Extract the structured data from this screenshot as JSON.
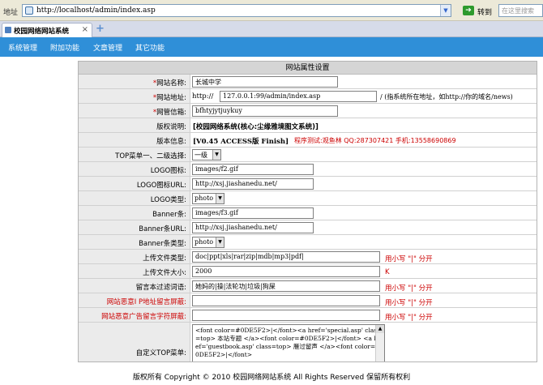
{
  "browser": {
    "address_label": "地址",
    "url": "http://localhost/admin/index.asp",
    "go_label": "转到",
    "search_placeholder": "在这里搜索",
    "tab_title": "校园网络网站系统",
    "tab_close": "×",
    "new_tab": "+"
  },
  "nav": {
    "items": [
      "系统管理",
      "附加功能",
      "文章管理",
      "其它功能"
    ]
  },
  "panel": {
    "title": "网站属性设置",
    "rows": {
      "site_name": {
        "label": "网站名称:",
        "value": "长城中学"
      },
      "site_url": {
        "label": "网站地址:",
        "prefix": "http://",
        "value": "127.0.0.1:99/admin/index.asp",
        "hint": "/ (指系统所在地址，如http://你的域名/news)"
      },
      "admin_email": {
        "label": "网管信箱:",
        "value": "bfhtyjytjuykuy"
      },
      "copyright": {
        "label": "版权说明:",
        "value": "[校园网络系统(核心:尘缘雅境图文系统)]"
      },
      "version": {
        "label": "版本信息:",
        "value": "[V0.45 ACCESS版 Finish]",
        "note": "程序测试:观鱼林 QQ:287307421 手机:13558690869"
      },
      "top_menu": {
        "label": "TOP菜单一、二级选择:",
        "value": "一级"
      },
      "logo_icon": {
        "label": "LOGO图标:",
        "value": "images/f2.gif"
      },
      "logo_url": {
        "label": "LOGO图标URL:",
        "value": "http://xsj.jiashanedu.net/"
      },
      "logo_type": {
        "label": "LOGO类型:",
        "value": "photo"
      },
      "banner": {
        "label": "Banner条:",
        "value": "images/f3.gif"
      },
      "banner_url": {
        "label": "Banner条URL:",
        "value": "http://xsj.jiashanedu.net/"
      },
      "banner_type": {
        "label": "Banner条类型:",
        "value": "photo"
      },
      "upload_types": {
        "label": "上传文件类型:",
        "value": "doc|ppt|xls|rar|zip|mdb|mp3|pdf|",
        "hint": "用小写 \"|\" 分开"
      },
      "upload_size": {
        "label": "上传文件大小:",
        "value": "2000",
        "hint": "K"
      },
      "filter_words": {
        "label": "留言本过滤词语:",
        "value": "她妈的|操|法轮功|垃圾|狗屎",
        "hint": "用小写 \"|\" 分开"
      },
      "ip_block": {
        "label": "网站恶意I P地址留言屏蔽:",
        "value": "",
        "hint": "用小写 \"|\" 分开"
      },
      "ad_block": {
        "label": "网站恶意广告留言字符屏蔽:",
        "value": "",
        "hint": "用小写 \"|\" 分开"
      },
      "custom_top": {
        "label": "自定义TOP菜单:",
        "value": "<font color=#0DE5F2>|</font><a href='special.asp' class=top> 本站专题 </a><font color=#0DE5F2>|</font> <a href='guestbook.asp' class=top> 雁过留声 </a><font color=#0DE5F2>|</font>"
      }
    }
  },
  "footer": "版权所有 Copyright © 2010 校园网络网站系统 All Rights Reserved 保留所有权利"
}
